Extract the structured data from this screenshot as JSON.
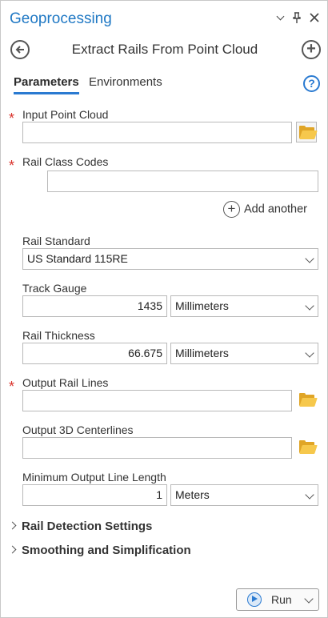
{
  "header": {
    "title": "Geoprocessing",
    "menu_icon": "chevron-down-icon",
    "pin_icon": "pin-icon",
    "close_icon": "close-icon"
  },
  "toolbar": {
    "back_icon": "back-arrow-icon",
    "tool_name": "Extract Rails From Point Cloud",
    "add_icon": "plus-icon"
  },
  "tabs": {
    "parameters": "Parameters",
    "environments": "Environments",
    "help_icon": "help-icon"
  },
  "params": {
    "input_point_cloud": {
      "label": "Input Point Cloud",
      "value": "",
      "required": true
    },
    "rail_class_codes": {
      "label": "Rail Class Codes",
      "value": "",
      "required": true
    },
    "add_another": "Add another",
    "rail_standard": {
      "label": "Rail Standard",
      "value": "US Standard 115RE"
    },
    "track_gauge": {
      "label": "Track Gauge",
      "value": "1435",
      "unit": "Millimeters"
    },
    "rail_thickness": {
      "label": "Rail Thickness",
      "value": "66.675",
      "unit": "Millimeters"
    },
    "output_rail_lines": {
      "label": "Output Rail Lines",
      "value": "",
      "required": true
    },
    "output_3d_centerlines": {
      "label": "Output 3D Centerlines",
      "value": ""
    },
    "min_output_line_length": {
      "label": "Minimum Output Line Length",
      "value": "1",
      "unit": "Meters"
    }
  },
  "sections": {
    "rail_detection": "Rail Detection Settings",
    "smoothing": "Smoothing and Simplification"
  },
  "footer": {
    "run_label": "Run"
  },
  "colors": {
    "accent": "#1f78c4",
    "required": "#d9322b",
    "folder": "#f6c84c"
  }
}
